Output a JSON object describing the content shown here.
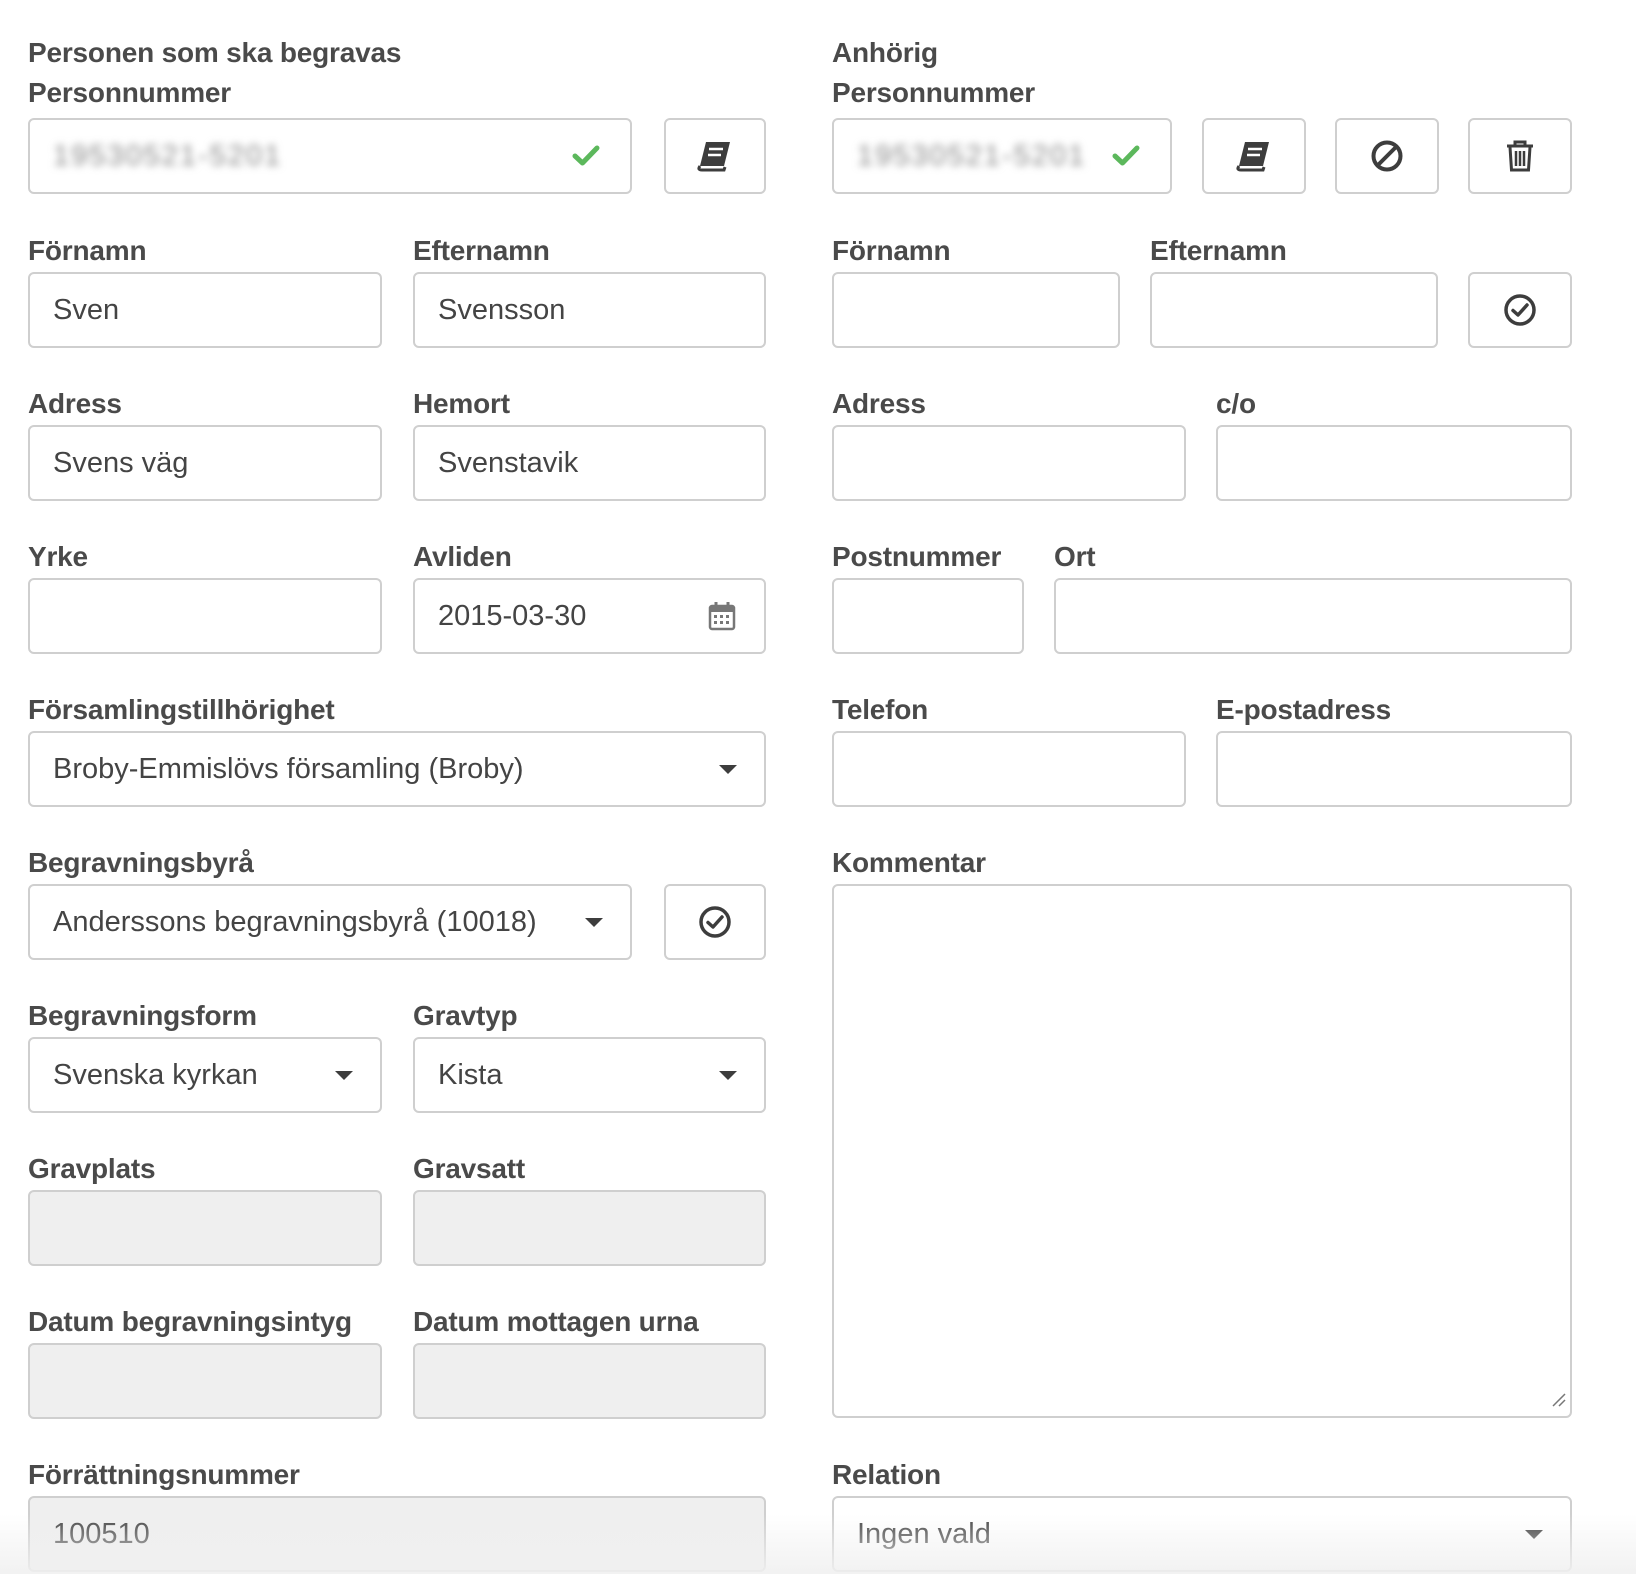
{
  "left": {
    "heading": "Personen som ska begravas",
    "personnummer_label": "Personnummer",
    "personnummer_value": "19530521-5201",
    "fornamn_label": "Förnamn",
    "fornamn_value": "Sven",
    "efternamn_label": "Efternamn",
    "efternamn_value": "Svensson",
    "adress_label": "Adress",
    "adress_value": "Svens väg",
    "hemort_label": "Hemort",
    "hemort_value": "Svenstavik",
    "yrke_label": "Yrke",
    "yrke_value": "",
    "avliden_label": "Avliden",
    "avliden_value": "2015-03-30",
    "forsamling_label": "Församlingstillhörighet",
    "forsamling_value": "Broby-Emmislövs församling (Broby)",
    "byra_label": "Begravningsbyrå",
    "byra_value": "Anderssons begravningsbyrå (10018)",
    "form_label": "Begravningsform",
    "form_value": "Svenska kyrkan",
    "gravtyp_label": "Gravtyp",
    "gravtyp_value": "Kista",
    "gravplats_label": "Gravplats",
    "gravplats_value": "",
    "gravsatt_label": "Gravsatt",
    "gravsatt_value": "",
    "datum_intyg_label": "Datum begravningsintyg",
    "datum_intyg_value": "",
    "datum_urna_label": "Datum mottagen urna",
    "datum_urna_value": "",
    "forrattning_label": "Förrättningsnummer",
    "forrattning_value": "100510"
  },
  "right": {
    "heading": "Anhörig",
    "personnummer_label": "Personnummer",
    "personnummer_value": "19530521-5201",
    "fornamn_label": "Förnamn",
    "fornamn_value": "",
    "efternamn_label": "Efternamn",
    "efternamn_value": "",
    "adress_label": "Adress",
    "adress_value": "",
    "co_label": "c/o",
    "co_value": "",
    "postnummer_label": "Postnummer",
    "postnummer_value": "",
    "ort_label": "Ort",
    "ort_value": "",
    "telefon_label": "Telefon",
    "telefon_value": "",
    "epost_label": "E-postadress",
    "epost_value": "",
    "kommentar_label": "Kommentar",
    "kommentar_value": "",
    "relation_label": "Relation",
    "relation_value": "Ingen vald"
  },
  "icons": {
    "valid": "check-icon",
    "lookup": "book-icon",
    "clear": "ban-icon",
    "delete": "trash-icon",
    "confirm": "check-circle-icon",
    "date": "calendar-icon",
    "dropdown": "caret-down-icon"
  },
  "colors": {
    "valid_check": "#5cb85c",
    "border": "#cfcfcf",
    "disabled_bg": "#efefef",
    "text": "#444444"
  }
}
